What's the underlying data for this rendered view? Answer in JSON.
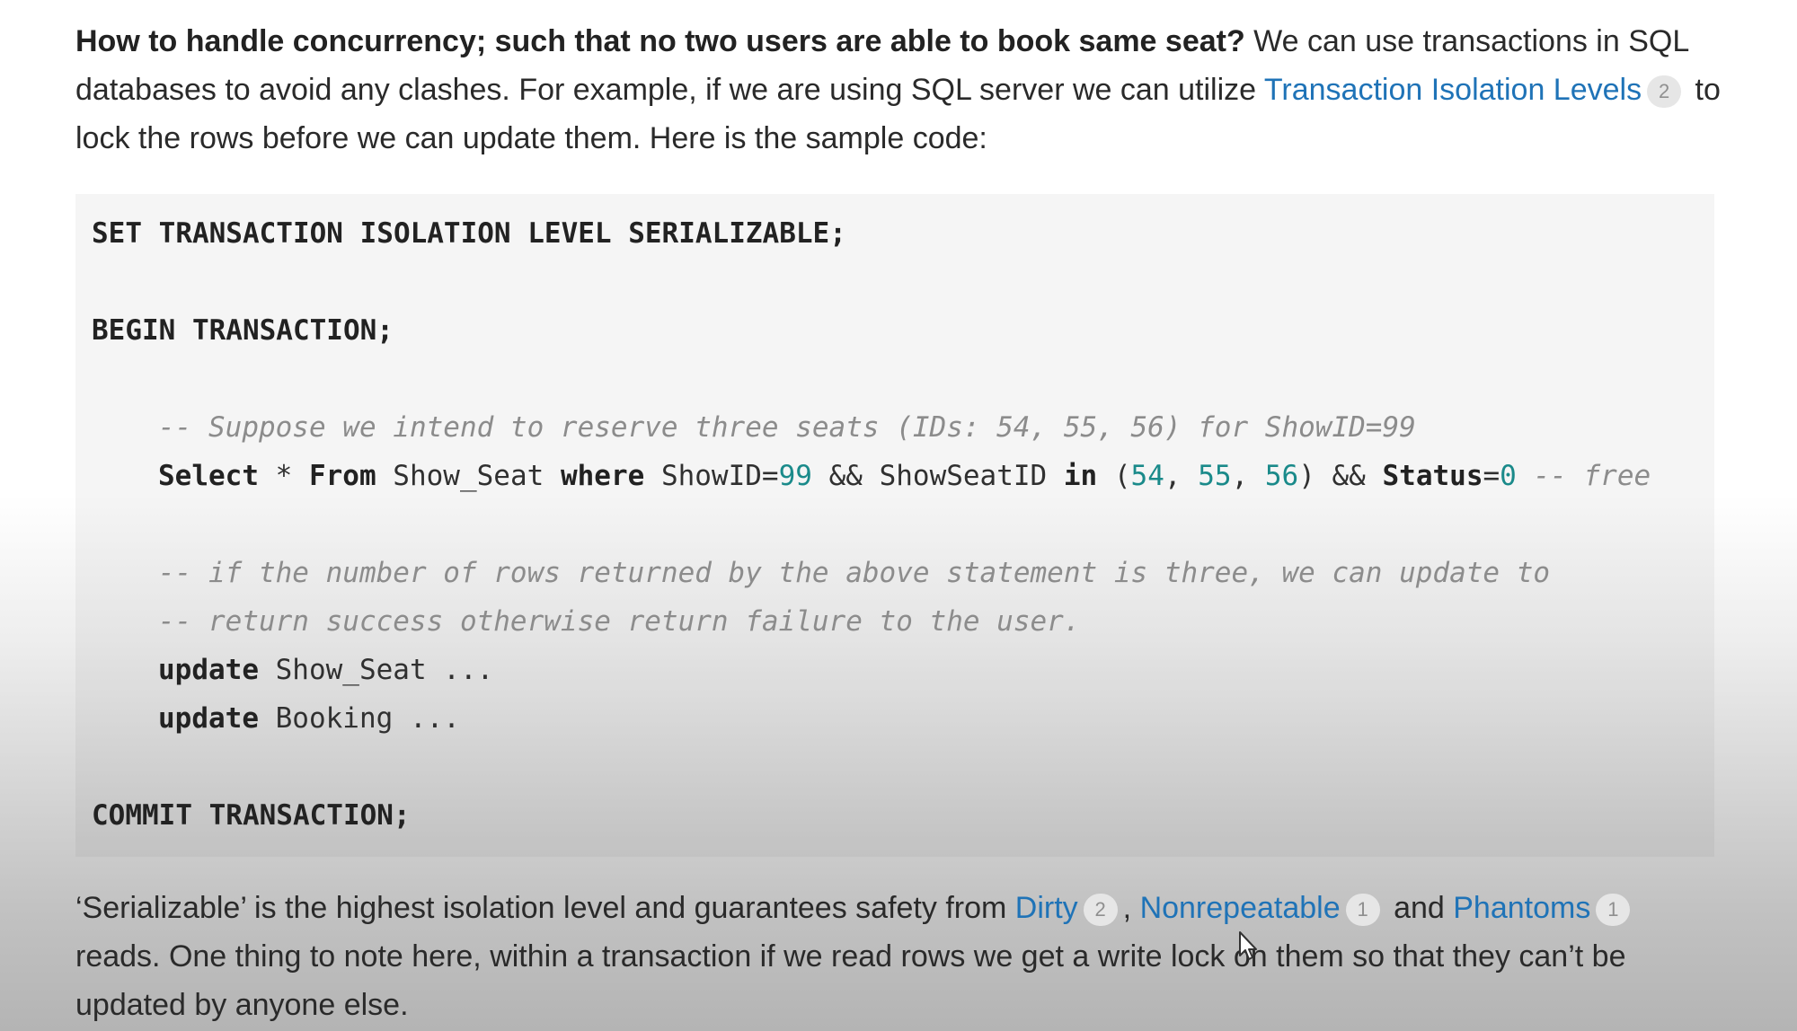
{
  "para1": {
    "question": "How to handle concurrency; such that no two users are able to book same seat?",
    "text_a": " We can use transactions in SQL databases to avoid any clashes. For example, if we are using SQL server we can utilize ",
    "link": "Transaction Isolation Levels",
    "link_count": "2",
    "text_b": " to lock the rows before we can update them. Here is the sample code:"
  },
  "code": {
    "line1": "SET TRANSACTION ISOLATION LEVEL SERIALIZABLE;",
    "line2": "BEGIN TRANSACTION;",
    "comment1": "-- Suppose we intend to reserve three seats (IDs: 54, 55, 56) for ShowID=99",
    "select": {
      "kw_select": "Select",
      "t1": " * ",
      "kw_from": "From",
      "t2": " Show_Seat ",
      "kw_where": "where",
      "t3": " ShowID=",
      "n99": "99",
      "t4": " && ShowSeatID ",
      "kw_in": "in",
      "t5": " (",
      "n54": "54",
      "t6": ", ",
      "n55": "55",
      "t7": ", ",
      "n56": "56",
      "t8": ") && ",
      "kw_status": "Status",
      "t9": "=",
      "n0": "0",
      "cmt": " -- free"
    },
    "comment2": "-- if the number of rows returned by the above statement is three, we can update to",
    "comment3": "-- return success otherwise return failure to the user.",
    "update_kw": "update",
    "update1_rest": " Show_Seat ...",
    "update2_rest": " Booking ...",
    "commit": "COMMIT TRANSACTION;"
  },
  "para2": {
    "t1": "‘Serializable’ is the highest isolation level and guarantees safety from ",
    "dirty": "Dirty",
    "dirty_count": "2",
    "comma": ", ",
    "nonrepeatable": "Nonrepeatable",
    "nonrepeatable_count": "1",
    "and": " and ",
    "phantoms": "Phantoms",
    "phantoms_count": "1",
    "t2": " reads. One thing to note here, within a transaction if we read rows we get a write lock on them so that they can’t be updated by anyone else."
  },
  "colors": {
    "link": "#1f73b7",
    "number": "#1a8a8a",
    "comment": "#8c8c8c"
  }
}
